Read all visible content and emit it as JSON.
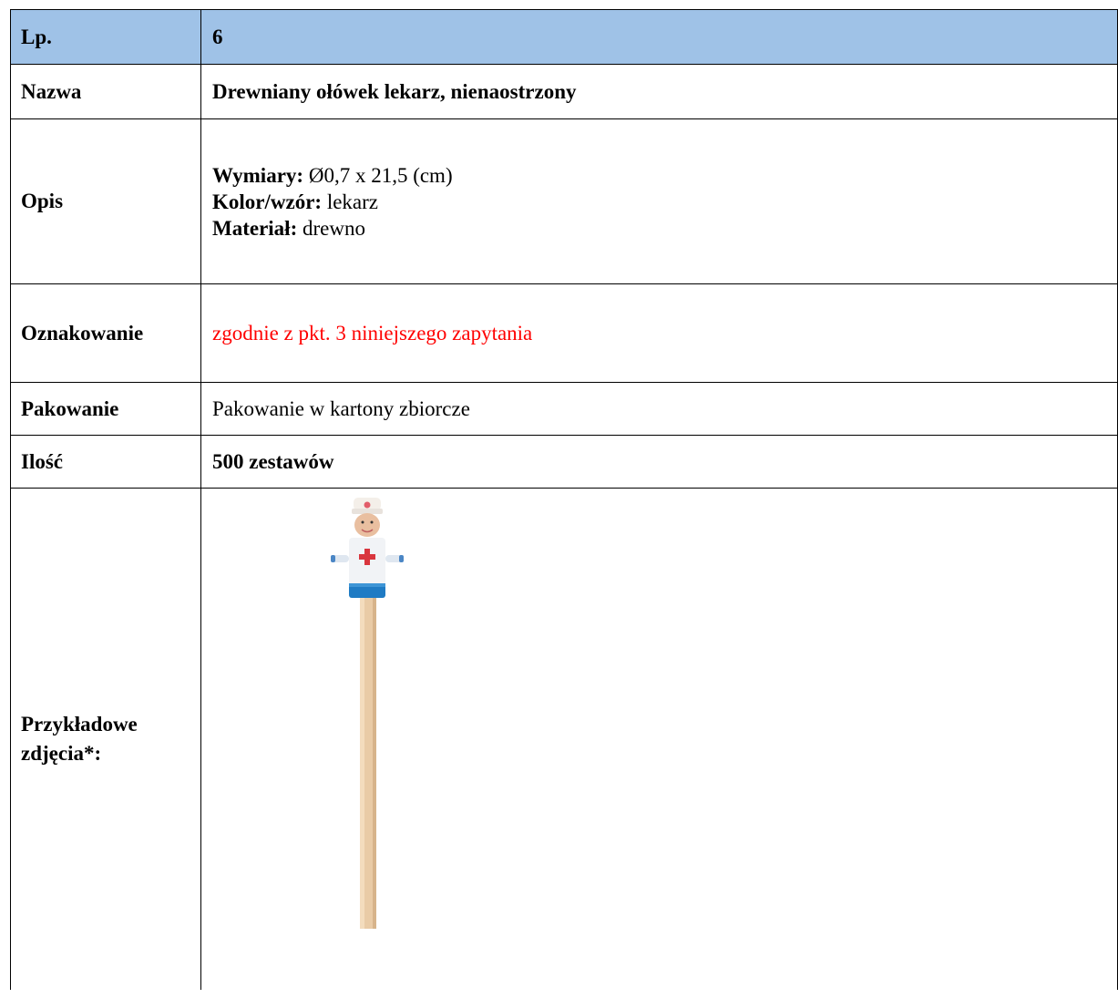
{
  "table": {
    "rows": [
      {
        "label": "Lp.",
        "value": "6"
      },
      {
        "label": "Nazwa",
        "value": "Drewniany ołówek lekarz, nienaostrzony"
      },
      {
        "label": "Opis",
        "value": ""
      },
      {
        "label": "Oznakowanie",
        "value": "zgodnie z pkt. 3 niniejszego zapytania"
      },
      {
        "label": "Pakowanie",
        "value": "Pakowanie w kartony zbiorcze"
      },
      {
        "label": "Ilość",
        "value": "500 zestawów"
      },
      {
        "label": "Przykładowe zdjęcia*:",
        "value": ""
      }
    ],
    "description": [
      {
        "key": "Wymiary:",
        "value": " Ø0,7 x 21,5 (cm)"
      },
      {
        "key": "Kolor/wzór:",
        "value": " lekarz"
      },
      {
        "key": "Materiał:",
        "value": " drewno"
      }
    ]
  },
  "colors": {
    "header_bg": "#9fc2e7",
    "highlight_text": "#ff0000"
  },
  "photo": {
    "icon": "doctor-pencil-image"
  }
}
